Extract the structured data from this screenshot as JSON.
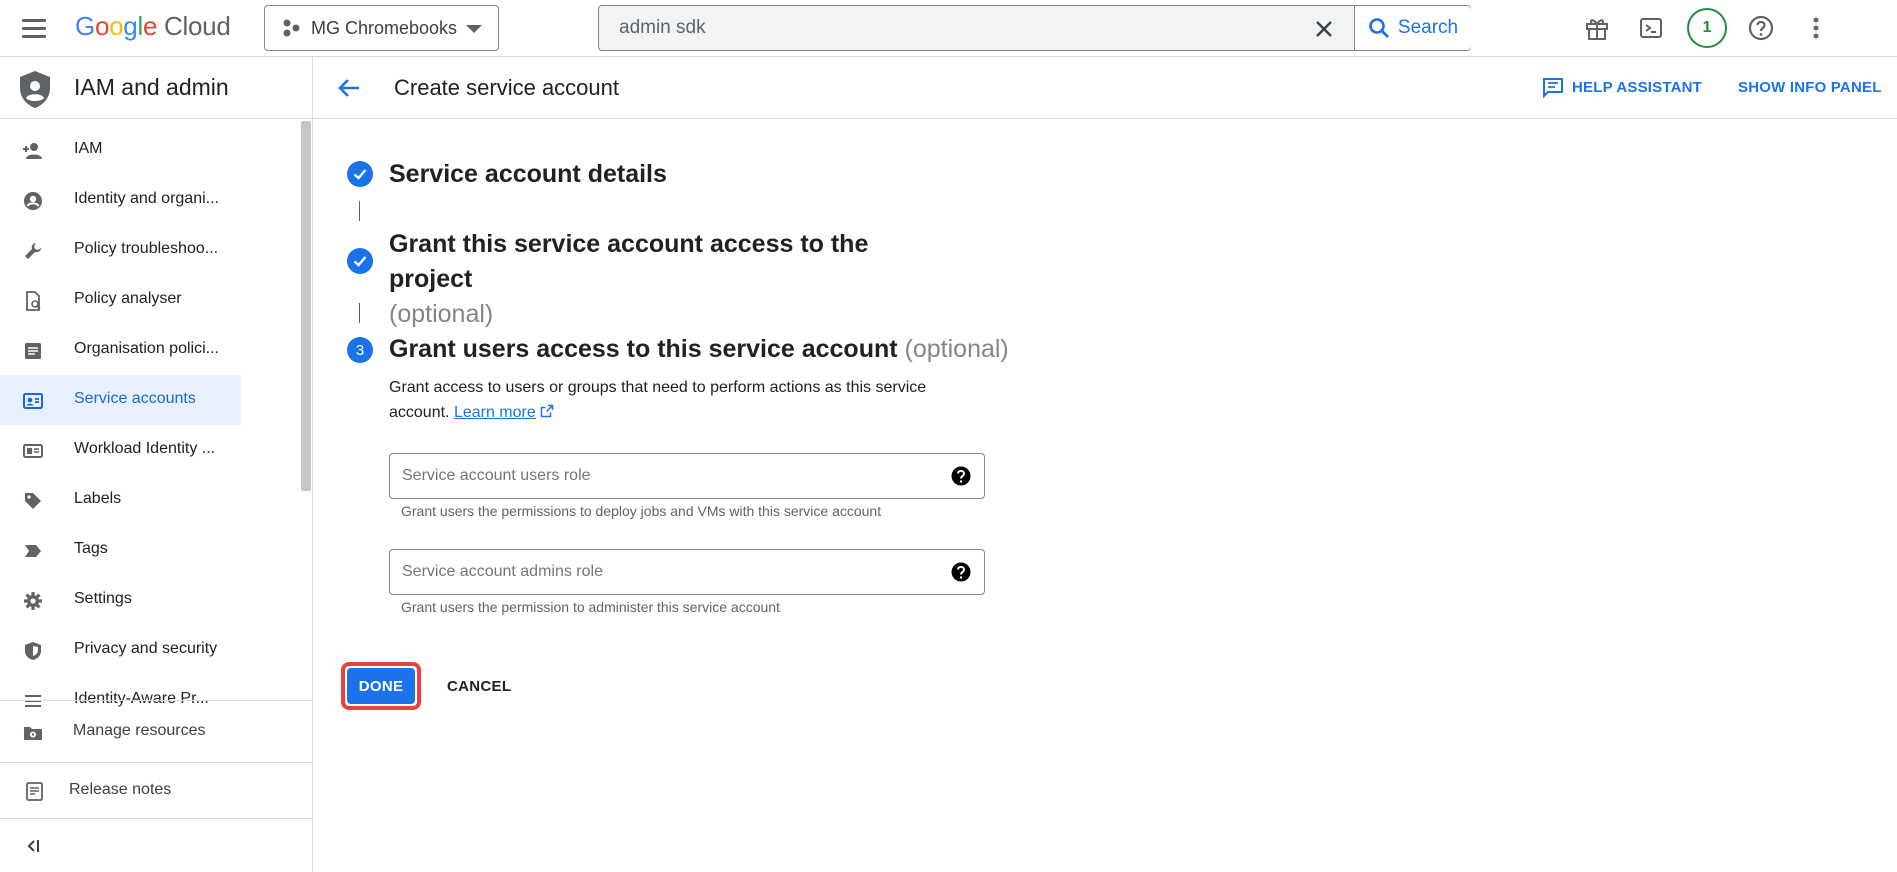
{
  "header": {
    "logo": {
      "google": "Google",
      "cloud": "Cloud"
    },
    "project": "MG Chromebooks",
    "search": {
      "value": "admin sdk",
      "button_label": "Search"
    },
    "notification_count": "1"
  },
  "sidebar": {
    "title": "IAM and admin",
    "items": [
      {
        "label": "IAM",
        "icon": "person-add-icon"
      },
      {
        "label": "Identity and organi...",
        "icon": "account-circle-icon"
      },
      {
        "label": "Policy troubleshoo...",
        "icon": "wrench-icon"
      },
      {
        "label": "Policy analyser",
        "icon": "policy-document-icon"
      },
      {
        "label": "Organisation polici...",
        "icon": "list-document-icon"
      },
      {
        "label": "Service accounts",
        "icon": "service-account-icon",
        "active": true
      },
      {
        "label": "Workload Identity ...",
        "icon": "id-card-icon"
      },
      {
        "label": "Labels",
        "icon": "label-icon"
      },
      {
        "label": "Tags",
        "icon": "tag-icon"
      },
      {
        "label": "Settings",
        "icon": "gear-icon"
      },
      {
        "label": "Privacy and security",
        "icon": "shield-icon"
      },
      {
        "label": "Identity-Aware Pr...",
        "icon": "list-icon"
      }
    ],
    "footer": {
      "manage_resources": "Manage resources",
      "release_notes": "Release notes"
    }
  },
  "page": {
    "title": "Create service account",
    "help_assistant": "HELP ASSISTANT",
    "show_info_panel": "SHOW INFO PANEL"
  },
  "steps": [
    {
      "title": "Service account details",
      "state": "complete"
    },
    {
      "title": "Grant this service account access to the project",
      "optional": "(optional)",
      "state": "complete"
    },
    {
      "number": "3",
      "title": "Grant users access to this service account",
      "optional": "(optional)",
      "state": "active",
      "description": "Grant access to users or groups that need to perform actions as this service account.",
      "learn_more": "Learn more"
    }
  ],
  "fields": {
    "users_role": {
      "placeholder": "Service account users role",
      "hint": "Grant users the permissions to deploy jobs and VMs with this service account"
    },
    "admins_role": {
      "placeholder": "Service account admins role",
      "hint": "Grant users the permission to administer this service account"
    }
  },
  "actions": {
    "done": "DONE",
    "cancel": "CANCEL"
  },
  "colors": {
    "accent": "#1a73e8",
    "highlight": "#ea4335",
    "active_bg": "#e8f0fe"
  }
}
